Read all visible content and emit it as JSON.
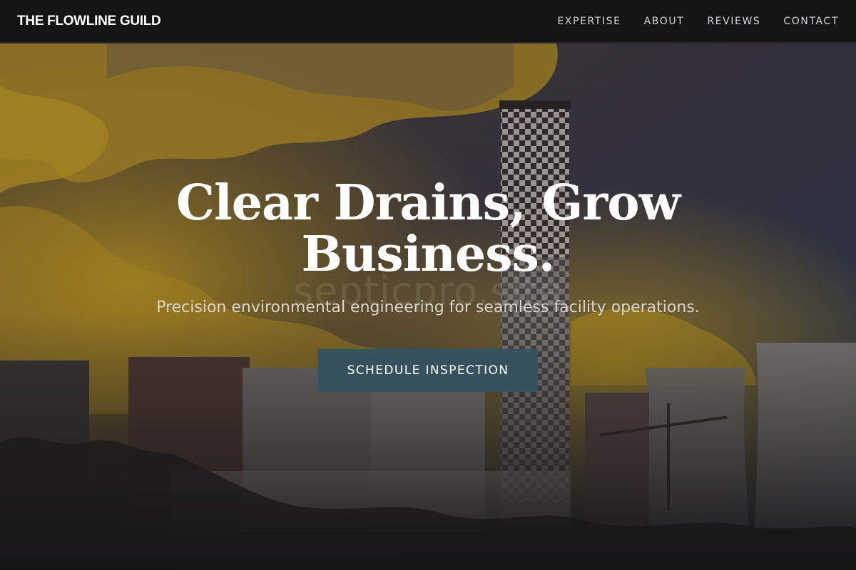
{
  "navbar": {
    "brand": "THE FLOWLINE GUILD",
    "links": [
      {
        "label": "EXPERTISE"
      },
      {
        "label": "ABOUT"
      },
      {
        "label": "REVIEWS"
      },
      {
        "label": "CONTACT"
      }
    ]
  },
  "hero": {
    "title": "Clear Drains, Grow Business.",
    "watermark": "septicpro.site",
    "subtitle": "Precision environmental engineering for seamless facility operations.",
    "cta_label": "SCHEDULE INSPECTION",
    "background_image": "industrial-smokestack-photo"
  },
  "colors": {
    "navbar_bg": "#141415",
    "cta_bg": "#37525f",
    "text_primary": "#ffffff",
    "smoke_yellow": "#e0b21a"
  }
}
